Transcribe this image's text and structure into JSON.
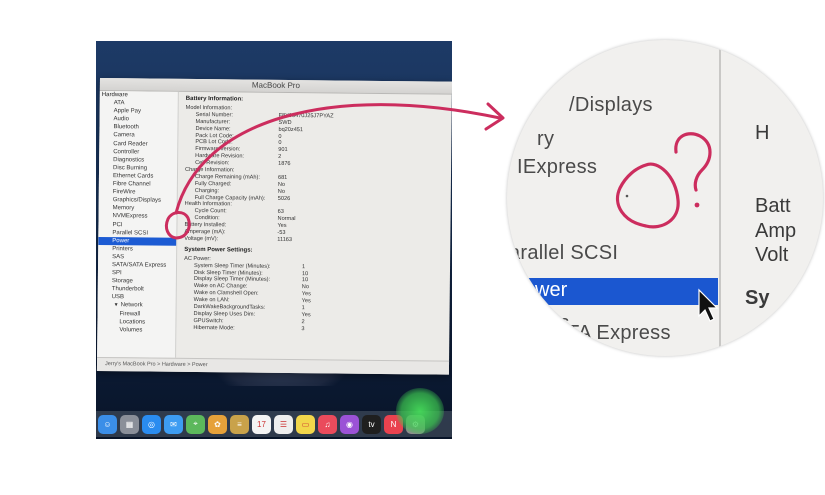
{
  "window": {
    "title": "MacBook Pro"
  },
  "sidebar": {
    "items": [
      {
        "label": "Hardware",
        "kind": "head"
      },
      {
        "label": "ATA",
        "kind": "item"
      },
      {
        "label": "Apple Pay",
        "kind": "item"
      },
      {
        "label": "Audio",
        "kind": "item"
      },
      {
        "label": "Bluetooth",
        "kind": "item"
      },
      {
        "label": "Camera",
        "kind": "item"
      },
      {
        "label": "Card Reader",
        "kind": "item"
      },
      {
        "label": "Controller",
        "kind": "item"
      },
      {
        "label": "Diagnostics",
        "kind": "item"
      },
      {
        "label": "Disc Burning",
        "kind": "item"
      },
      {
        "label": "Ethernet Cards",
        "kind": "item"
      },
      {
        "label": "Fibre Channel",
        "kind": "item"
      },
      {
        "label": "FireWire",
        "kind": "item"
      },
      {
        "label": "Graphics/Displays",
        "kind": "item"
      },
      {
        "label": "Memory",
        "kind": "item"
      },
      {
        "label": "NVMExpress",
        "kind": "item"
      },
      {
        "label": "PCI",
        "kind": "item"
      },
      {
        "label": "Parallel SCSI",
        "kind": "item"
      },
      {
        "label": "Power",
        "kind": "selected"
      },
      {
        "label": "Printers",
        "kind": "item"
      },
      {
        "label": "SAS",
        "kind": "item"
      },
      {
        "label": "SATA/SATA Express",
        "kind": "item"
      },
      {
        "label": "SPI",
        "kind": "item"
      },
      {
        "label": "Storage",
        "kind": "item"
      },
      {
        "label": "Thunderbolt",
        "kind": "item"
      },
      {
        "label": "USB",
        "kind": "item"
      },
      {
        "label": "Network",
        "kind": "sub"
      },
      {
        "label": "Firewall",
        "kind": "sub2"
      },
      {
        "label": "Locations",
        "kind": "sub2"
      },
      {
        "label": "Volumes",
        "kind": "sub2"
      }
    ]
  },
  "content": {
    "battery_title": "Battery Information:",
    "battery_rows": [
      {
        "k": "Model Information:",
        "v": "",
        "indent": 1
      },
      {
        "k": "Serial Number:",
        "v": "F8Y93470J25J7PYAZ",
        "indent": 2
      },
      {
        "k": "Manufacturer:",
        "v": "SWD",
        "indent": 2
      },
      {
        "k": "Device Name:",
        "v": "bq20z451",
        "indent": 2
      },
      {
        "k": "Pack Lot Code:",
        "v": "0",
        "indent": 2
      },
      {
        "k": "PCB Lot Code:",
        "v": "0",
        "indent": 2
      },
      {
        "k": "Firmware Version:",
        "v": "901",
        "indent": 2
      },
      {
        "k": "Hardware Revision:",
        "v": "2",
        "indent": 2
      },
      {
        "k": "Cell Revision:",
        "v": "1876",
        "indent": 2
      },
      {
        "k": "Charge Information:",
        "v": "",
        "indent": 1
      },
      {
        "k": "Charge Remaining (mAh):",
        "v": "681",
        "indent": 2
      },
      {
        "k": "Fully Charged:",
        "v": "No",
        "indent": 2
      },
      {
        "k": "Charging:",
        "v": "No",
        "indent": 2
      },
      {
        "k": "Full Charge Capacity (mAh):",
        "v": "5026",
        "indent": 2
      },
      {
        "k": "Health Information:",
        "v": "",
        "indent": 1
      },
      {
        "k": "Cycle Count:",
        "v": "63",
        "indent": 2
      },
      {
        "k": "Condition:",
        "v": "Normal",
        "indent": 2
      },
      {
        "k": "Battery Installed:",
        "v": "Yes",
        "indent": 1
      },
      {
        "k": "Amperage (mA):",
        "v": "-53",
        "indent": 1
      },
      {
        "k": "Voltage (mV):",
        "v": "11163",
        "indent": 1
      }
    ],
    "power_title": "System Power Settings:",
    "power_rows": [
      {
        "k": "AC Power:",
        "v": "",
        "indent": 1
      },
      {
        "k": "System Sleep Timer (Minutes):",
        "v": "1",
        "indent": 2
      },
      {
        "k": "Disk Sleep Timer (Minutes):",
        "v": "10",
        "indent": 2
      },
      {
        "k": "Display Sleep Timer (Minutes):",
        "v": "10",
        "indent": 2
      },
      {
        "k": "Wake on AC Change:",
        "v": "No",
        "indent": 2
      },
      {
        "k": "Wake on Clamshell Open:",
        "v": "Yes",
        "indent": 2
      },
      {
        "k": "Wake on LAN:",
        "v": "Yes",
        "indent": 2
      },
      {
        "k": "DarkWakeBackgroundTasks:",
        "v": "1",
        "indent": 2
      },
      {
        "k": "Display Sleep Uses Dim:",
        "v": "Yes",
        "indent": 2
      },
      {
        "k": "GPUSwitch:",
        "v": "2",
        "indent": 2
      },
      {
        "k": "Hibernate Mode:",
        "v": "3",
        "indent": 2
      }
    ]
  },
  "statusbar": {
    "path": "Jerry's MacBook Pro > Hardware > Power"
  },
  "dock": {
    "icons": [
      {
        "name": "finder-icon",
        "color": "#3b8ee8",
        "glyph": "☺"
      },
      {
        "name": "launchpad-icon",
        "color": "#8a8f99",
        "glyph": "▦"
      },
      {
        "name": "safari-icon",
        "color": "#2a8cf0",
        "glyph": "◎"
      },
      {
        "name": "mail-icon",
        "color": "#3d9cf2",
        "glyph": "✉"
      },
      {
        "name": "maps-icon",
        "color": "#5cb85c",
        "glyph": "⌖"
      },
      {
        "name": "photos-icon",
        "color": "#e6a13a",
        "glyph": "✿"
      },
      {
        "name": "notes-icon",
        "color": "#c9a24a",
        "glyph": "≡"
      },
      {
        "name": "calendar-icon",
        "color": "#f4f4f4",
        "glyph": "17",
        "dark": true
      },
      {
        "name": "reminders-icon",
        "color": "#eeeeee",
        "glyph": "☰",
        "dark": true
      },
      {
        "name": "stickies-icon",
        "color": "#f2d64b",
        "glyph": "▭",
        "dark": true
      },
      {
        "name": "music-icon",
        "color": "#ea4b5c",
        "glyph": "♫"
      },
      {
        "name": "podcasts-icon",
        "color": "#9b52d6",
        "glyph": "◉"
      },
      {
        "name": "tv-icon",
        "color": "#1f1f1f",
        "glyph": "tv"
      },
      {
        "name": "news-icon",
        "color": "#e9424f",
        "glyph": "N"
      },
      {
        "name": "settings-icon",
        "color": "#8d8d8d",
        "glyph": "⚙"
      }
    ]
  },
  "zoom": {
    "lines": [
      {
        "text": "/Displays"
      },
      {
        "text": "ry"
      },
      {
        "text": "IExpress"
      },
      {
        "text": "arallel SCSI"
      },
      {
        "text": "ters"
      },
      {
        "text": "TA Express"
      }
    ],
    "selected": "wer",
    "right": [
      "H",
      "Batt",
      "Amp",
      "Volt",
      "Sy"
    ]
  },
  "annotation": {
    "note": "?"
  }
}
